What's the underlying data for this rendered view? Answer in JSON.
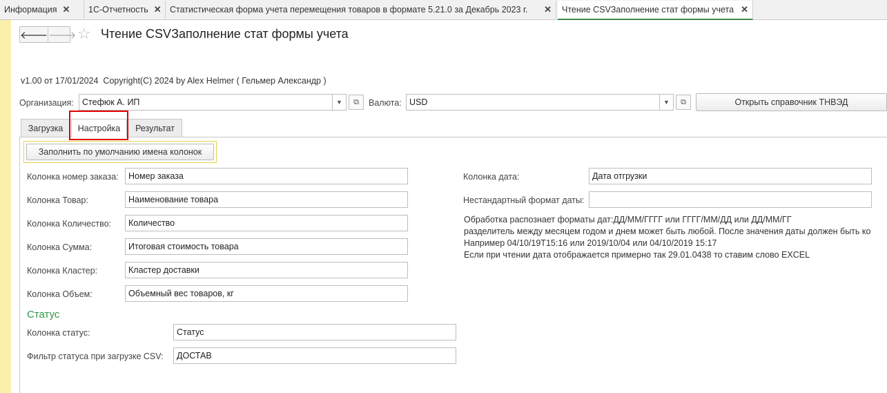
{
  "window_tabs": [
    {
      "label": "Информация"
    },
    {
      "label": "1С-Отчетность"
    },
    {
      "label": "Статистическая форма учета перемещения товаров в формате 5.21.0 за Декабрь 2023 г."
    },
    {
      "label": "Чтение CSVЗаполнение стат формы учета",
      "active": true
    }
  ],
  "header": {
    "back_icon": "arrow-left-icon",
    "forward_icon": "arrow-right-icon",
    "favorite_icon": "star-icon",
    "title": "Чтение CSVЗаполнение стат формы учета"
  },
  "version_text": "v1.00 от 17/01/2024  Copyright(C) 2024 by Alex Helmer ( Гельмер Александр )",
  "organization": {
    "label": "Организация:",
    "value": "Стефюк А. ИП"
  },
  "currency": {
    "label": "Валюта:",
    "value": "USD"
  },
  "tnved_button": "Открыть справочник ТНВЭД",
  "form_tabs": [
    {
      "label": "Загрузка"
    },
    {
      "label": "Настройка",
      "active": true
    },
    {
      "label": "Результат"
    }
  ],
  "fill_defaults_button": "Заполнить по умолчанию имена колонок",
  "columns": [
    {
      "label": "Колонка номер заказа:",
      "value": "Номер заказа"
    },
    {
      "label": "Колонка Товар:",
      "value": "Наименование товара"
    },
    {
      "label": "Колонка Количество:",
      "value": "Количество"
    },
    {
      "label": "Колонка Сумма:",
      "value": "Итоговая стоимость товара"
    },
    {
      "label": "Колонка Кластер:",
      "value": "Кластер доставки"
    },
    {
      "label": "Колонка Объем:",
      "value": "Объемный вес товаров, кг"
    }
  ],
  "date_column": {
    "label": "Колонка дата:",
    "value": "Дата отгрузки"
  },
  "custom_date_format": {
    "label": "Нестандартный формат даты:",
    "value": ""
  },
  "info_lines": [
    "Обработка распознает форматы дат:ДД/ММ/ГГГГ или ГГГГ/ММ/ДД или ДД/ММ/ГГ",
    "разделитель между месяцем годом и днем может быть любой. После значения даты должен быть ко",
    "Например 04/10/19T15:16 или 2019/10/04 или 04/10/2019 15:17",
    "Если при чтении дата отображается примерно так 29.01.0438 то ставим слово EXCEL"
  ],
  "status_section": {
    "heading": "Статус",
    "status_column": {
      "label": "Колонка статус:",
      "value": "Статус"
    },
    "status_filter": {
      "label": "Фильтр статуса при загрузке CSV:",
      "value": "ДОСТАВ"
    }
  },
  "colors": {
    "accent_green": "#2d9a46",
    "highlight_red": "#e00000",
    "left_strip": "#fbf0a9"
  }
}
